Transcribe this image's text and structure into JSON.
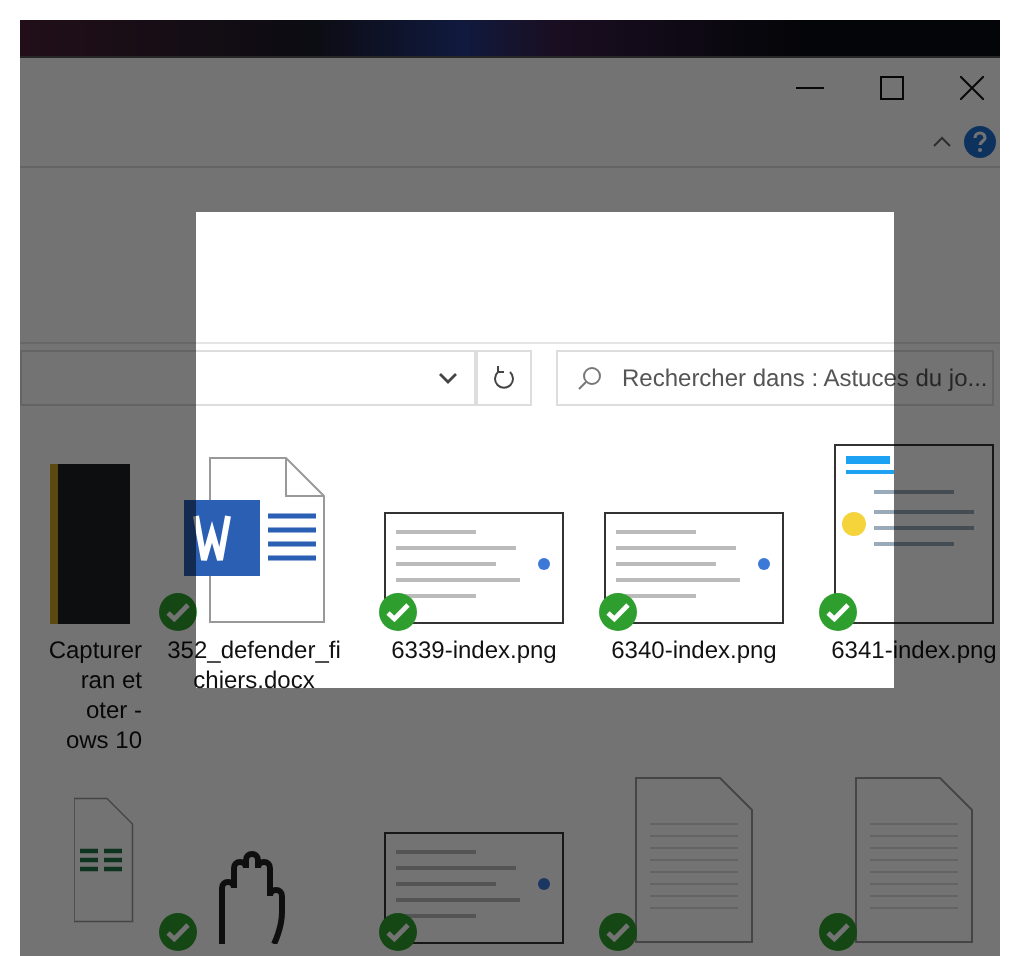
{
  "address_bar": {
    "refresh": true
  },
  "search": {
    "placeholder": "Rechercher dans : Astuces du jo..."
  },
  "files": [
    {
      "kind": "app",
      "lines": [
        "Capturer",
        "ran et",
        "oter -",
        "ows 10"
      ],
      "synced": false
    },
    {
      "kind": "word",
      "lines": [
        "352_defender_fi",
        "chiers.docx"
      ],
      "synced": true
    },
    {
      "kind": "settings",
      "lines": [
        "6339-index.png"
      ],
      "synced": true
    },
    {
      "kind": "resolution",
      "lines": [
        "6340-index.png"
      ],
      "synced": true
    },
    {
      "kind": "tweets",
      "lines": [
        "6341-index.png"
      ],
      "synced": true
    },
    {
      "kind": "excel",
      "synced": false
    },
    {
      "kind": "hand",
      "synced": true
    },
    {
      "kind": "article",
      "synced": true
    },
    {
      "kind": "blank",
      "synced": true
    },
    {
      "kind": "blank",
      "synced": true
    }
  ]
}
